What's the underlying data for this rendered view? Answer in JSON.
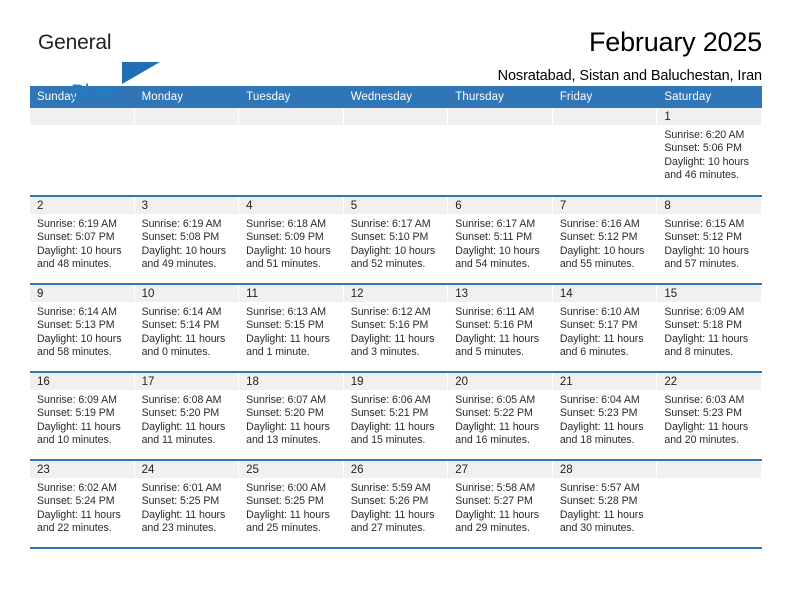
{
  "brand": {
    "name_top": "General",
    "name_bottom": "Blue",
    "triangle_color": "#1f6fb5",
    "bottom_color": "#1f7fc4"
  },
  "header": {
    "title": "February 2025",
    "subtitle": "Nosratabad, Sistan and Baluchestan, Iran"
  },
  "theme": {
    "header_blue": "#3075b5",
    "daynum_band": "#f0f0f0",
    "text": "#2b2b2b"
  },
  "weekdays": [
    "Sunday",
    "Monday",
    "Tuesday",
    "Wednesday",
    "Thursday",
    "Friday",
    "Saturday"
  ],
  "weeks": [
    [
      {
        "day": "",
        "empty": true,
        "sunrise": "",
        "sunset": "",
        "daylight1": "",
        "daylight2": ""
      },
      {
        "day": "",
        "empty": true,
        "sunrise": "",
        "sunset": "",
        "daylight1": "",
        "daylight2": ""
      },
      {
        "day": "",
        "empty": true,
        "sunrise": "",
        "sunset": "",
        "daylight1": "",
        "daylight2": ""
      },
      {
        "day": "",
        "empty": true,
        "sunrise": "",
        "sunset": "",
        "daylight1": "",
        "daylight2": ""
      },
      {
        "day": "",
        "empty": true,
        "sunrise": "",
        "sunset": "",
        "daylight1": "",
        "daylight2": ""
      },
      {
        "day": "",
        "empty": true,
        "sunrise": "",
        "sunset": "",
        "daylight1": "",
        "daylight2": ""
      },
      {
        "day": "1",
        "empty": false,
        "sunrise": "Sunrise: 6:20 AM",
        "sunset": "Sunset: 5:06 PM",
        "daylight1": "Daylight: 10 hours",
        "daylight2": "and 46 minutes."
      }
    ],
    [
      {
        "day": "2",
        "empty": false,
        "sunrise": "Sunrise: 6:19 AM",
        "sunset": "Sunset: 5:07 PM",
        "daylight1": "Daylight: 10 hours",
        "daylight2": "and 48 minutes."
      },
      {
        "day": "3",
        "empty": false,
        "sunrise": "Sunrise: 6:19 AM",
        "sunset": "Sunset: 5:08 PM",
        "daylight1": "Daylight: 10 hours",
        "daylight2": "and 49 minutes."
      },
      {
        "day": "4",
        "empty": false,
        "sunrise": "Sunrise: 6:18 AM",
        "sunset": "Sunset: 5:09 PM",
        "daylight1": "Daylight: 10 hours",
        "daylight2": "and 51 minutes."
      },
      {
        "day": "5",
        "empty": false,
        "sunrise": "Sunrise: 6:17 AM",
        "sunset": "Sunset: 5:10 PM",
        "daylight1": "Daylight: 10 hours",
        "daylight2": "and 52 minutes."
      },
      {
        "day": "6",
        "empty": false,
        "sunrise": "Sunrise: 6:17 AM",
        "sunset": "Sunset: 5:11 PM",
        "daylight1": "Daylight: 10 hours",
        "daylight2": "and 54 minutes."
      },
      {
        "day": "7",
        "empty": false,
        "sunrise": "Sunrise: 6:16 AM",
        "sunset": "Sunset: 5:12 PM",
        "daylight1": "Daylight: 10 hours",
        "daylight2": "and 55 minutes."
      },
      {
        "day": "8",
        "empty": false,
        "sunrise": "Sunrise: 6:15 AM",
        "sunset": "Sunset: 5:12 PM",
        "daylight1": "Daylight: 10 hours",
        "daylight2": "and 57 minutes."
      }
    ],
    [
      {
        "day": "9",
        "empty": false,
        "sunrise": "Sunrise: 6:14 AM",
        "sunset": "Sunset: 5:13 PM",
        "daylight1": "Daylight: 10 hours",
        "daylight2": "and 58 minutes."
      },
      {
        "day": "10",
        "empty": false,
        "sunrise": "Sunrise: 6:14 AM",
        "sunset": "Sunset: 5:14 PM",
        "daylight1": "Daylight: 11 hours",
        "daylight2": "and 0 minutes."
      },
      {
        "day": "11",
        "empty": false,
        "sunrise": "Sunrise: 6:13 AM",
        "sunset": "Sunset: 5:15 PM",
        "daylight1": "Daylight: 11 hours",
        "daylight2": "and 1 minute."
      },
      {
        "day": "12",
        "empty": false,
        "sunrise": "Sunrise: 6:12 AM",
        "sunset": "Sunset: 5:16 PM",
        "daylight1": "Daylight: 11 hours",
        "daylight2": "and 3 minutes."
      },
      {
        "day": "13",
        "empty": false,
        "sunrise": "Sunrise: 6:11 AM",
        "sunset": "Sunset: 5:16 PM",
        "daylight1": "Daylight: 11 hours",
        "daylight2": "and 5 minutes."
      },
      {
        "day": "14",
        "empty": false,
        "sunrise": "Sunrise: 6:10 AM",
        "sunset": "Sunset: 5:17 PM",
        "daylight1": "Daylight: 11 hours",
        "daylight2": "and 6 minutes."
      },
      {
        "day": "15",
        "empty": false,
        "sunrise": "Sunrise: 6:09 AM",
        "sunset": "Sunset: 5:18 PM",
        "daylight1": "Daylight: 11 hours",
        "daylight2": "and 8 minutes."
      }
    ],
    [
      {
        "day": "16",
        "empty": false,
        "sunrise": "Sunrise: 6:09 AM",
        "sunset": "Sunset: 5:19 PM",
        "daylight1": "Daylight: 11 hours",
        "daylight2": "and 10 minutes."
      },
      {
        "day": "17",
        "empty": false,
        "sunrise": "Sunrise: 6:08 AM",
        "sunset": "Sunset: 5:20 PM",
        "daylight1": "Daylight: 11 hours",
        "daylight2": "and 11 minutes."
      },
      {
        "day": "18",
        "empty": false,
        "sunrise": "Sunrise: 6:07 AM",
        "sunset": "Sunset: 5:20 PM",
        "daylight1": "Daylight: 11 hours",
        "daylight2": "and 13 minutes."
      },
      {
        "day": "19",
        "empty": false,
        "sunrise": "Sunrise: 6:06 AM",
        "sunset": "Sunset: 5:21 PM",
        "daylight1": "Daylight: 11 hours",
        "daylight2": "and 15 minutes."
      },
      {
        "day": "20",
        "empty": false,
        "sunrise": "Sunrise: 6:05 AM",
        "sunset": "Sunset: 5:22 PM",
        "daylight1": "Daylight: 11 hours",
        "daylight2": "and 16 minutes."
      },
      {
        "day": "21",
        "empty": false,
        "sunrise": "Sunrise: 6:04 AM",
        "sunset": "Sunset: 5:23 PM",
        "daylight1": "Daylight: 11 hours",
        "daylight2": "and 18 minutes."
      },
      {
        "day": "22",
        "empty": false,
        "sunrise": "Sunrise: 6:03 AM",
        "sunset": "Sunset: 5:23 PM",
        "daylight1": "Daylight: 11 hours",
        "daylight2": "and 20 minutes."
      }
    ],
    [
      {
        "day": "23",
        "empty": false,
        "sunrise": "Sunrise: 6:02 AM",
        "sunset": "Sunset: 5:24 PM",
        "daylight1": "Daylight: 11 hours",
        "daylight2": "and 22 minutes."
      },
      {
        "day": "24",
        "empty": false,
        "sunrise": "Sunrise: 6:01 AM",
        "sunset": "Sunset: 5:25 PM",
        "daylight1": "Daylight: 11 hours",
        "daylight2": "and 23 minutes."
      },
      {
        "day": "25",
        "empty": false,
        "sunrise": "Sunrise: 6:00 AM",
        "sunset": "Sunset: 5:25 PM",
        "daylight1": "Daylight: 11 hours",
        "daylight2": "and 25 minutes."
      },
      {
        "day": "26",
        "empty": false,
        "sunrise": "Sunrise: 5:59 AM",
        "sunset": "Sunset: 5:26 PM",
        "daylight1": "Daylight: 11 hours",
        "daylight2": "and 27 minutes."
      },
      {
        "day": "27",
        "empty": false,
        "sunrise": "Sunrise: 5:58 AM",
        "sunset": "Sunset: 5:27 PM",
        "daylight1": "Daylight: 11 hours",
        "daylight2": "and 29 minutes."
      },
      {
        "day": "28",
        "empty": false,
        "sunrise": "Sunrise: 5:57 AM",
        "sunset": "Sunset: 5:28 PM",
        "daylight1": "Daylight: 11 hours",
        "daylight2": "and 30 minutes."
      },
      {
        "day": "",
        "empty": true,
        "sunrise": "",
        "sunset": "",
        "daylight1": "",
        "daylight2": ""
      }
    ]
  ]
}
